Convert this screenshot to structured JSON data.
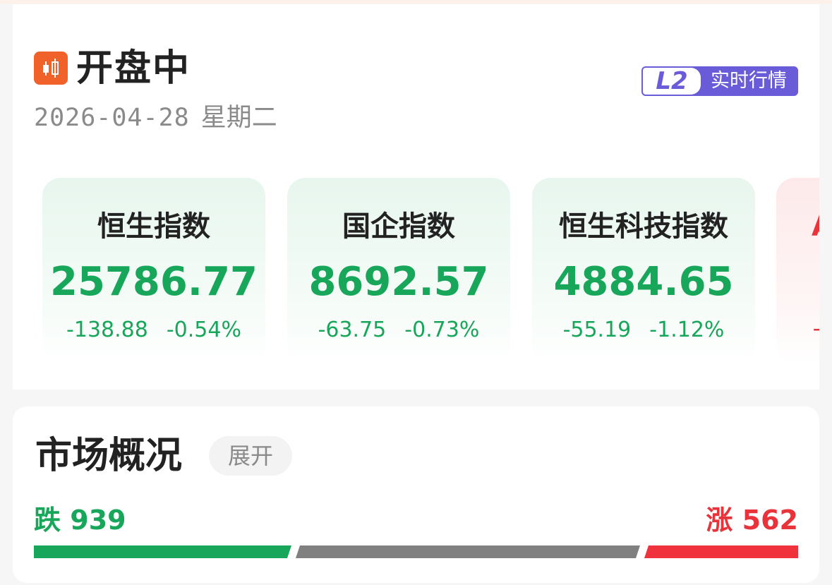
{
  "status": {
    "title": "开盘中",
    "icon": "candlestick-icon",
    "icon_color": "#f1622a"
  },
  "date": {
    "date": "2026-04-28",
    "weekday": "星期二"
  },
  "badge": {
    "level": "L2",
    "label": "实时行情",
    "color": "#6a5bd8"
  },
  "indices": [
    {
      "name": "恒生指数",
      "value": "25786.77",
      "change": "-138.88",
      "change_pct": "-0.54%"
    },
    {
      "name": "国企指数",
      "value": "8692.57",
      "change": "-63.75",
      "change_pct": "-0.73%"
    },
    {
      "name": "恒生科技指数",
      "value": "4884.65",
      "change": "-55.19",
      "change_pct": "-1.12%"
    },
    {
      "name": "A",
      "value": "",
      "change": "+",
      "change_pct": ""
    }
  ],
  "market": {
    "title": "市场概况",
    "expand_label": "展开",
    "down_label": "跌",
    "down_count": 939,
    "up_label": "涨",
    "up_count": 562,
    "flat_count_shown": false,
    "colors": {
      "down": "#18a65a",
      "flat": "#808080",
      "up": "#f0323c"
    }
  }
}
